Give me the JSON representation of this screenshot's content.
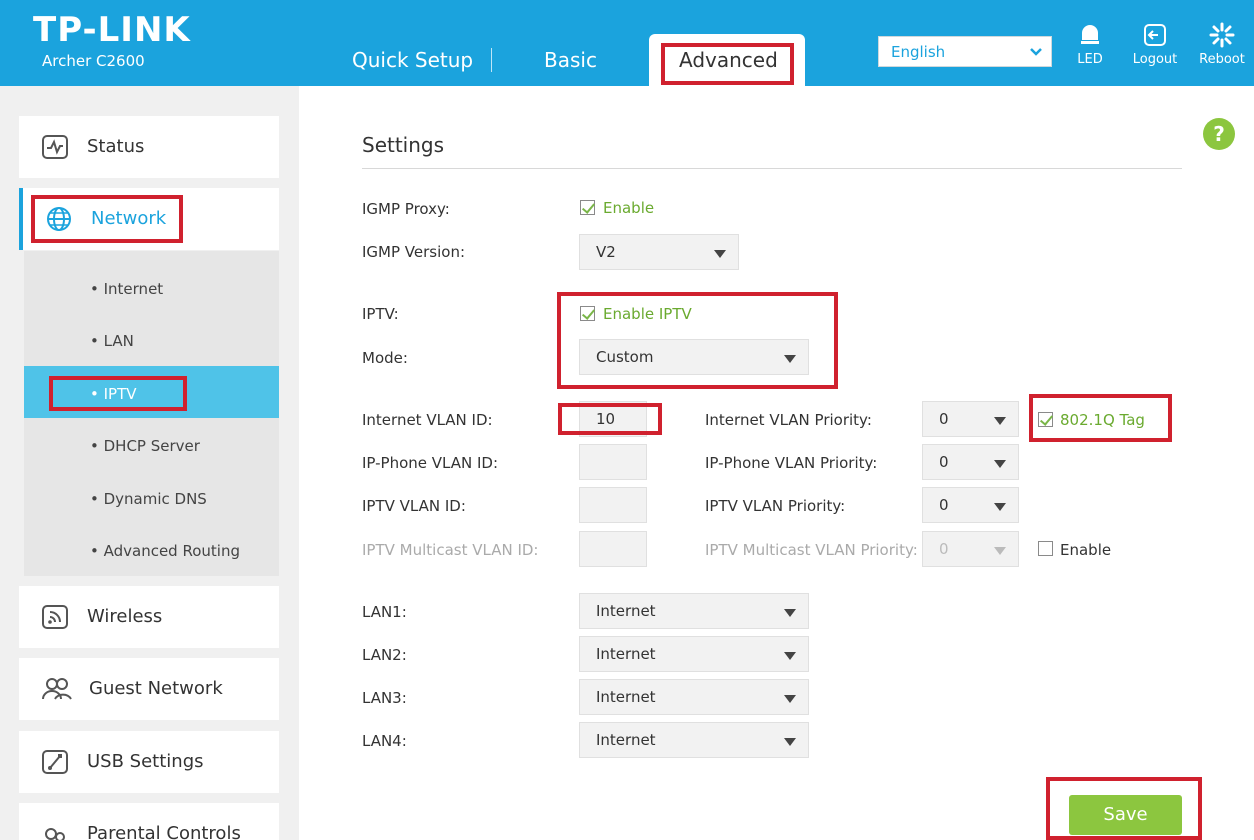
{
  "header": {
    "brand": "TP-LINK",
    "model": "Archer C2600",
    "tabs": {
      "quick_setup": "Quick Setup",
      "basic": "Basic",
      "advanced": "Advanced"
    },
    "language": "English",
    "led_label": "LED",
    "logout_label": "Logout",
    "reboot_label": "Reboot"
  },
  "sidebar": {
    "status": "Status",
    "network": "Network",
    "submenu": [
      "Internet",
      "LAN",
      "IPTV",
      "DHCP Server",
      "Dynamic DNS",
      "Advanced Routing"
    ],
    "wireless": "Wireless",
    "guest_network": "Guest Network",
    "usb_settings": "USB Settings",
    "parental_controls": "Parental Controls"
  },
  "settings": {
    "title": "Settings",
    "igmp_proxy_label": "IGMP Proxy:",
    "igmp_proxy_enable": "Enable",
    "igmp_version_label": "IGMP Version:",
    "igmp_version": "V2",
    "iptv_label": "IPTV:",
    "iptv_enable": "Enable IPTV",
    "mode_label": "Mode:",
    "mode": "Custom",
    "internet_vlan_id_label": "Internet VLAN ID:",
    "internet_vlan_id": "10",
    "internet_vlan_priority_label": "Internet VLAN Priority:",
    "internet_vlan_priority": "0",
    "tag_label": "802.1Q Tag",
    "ipphone_vlan_id_label": "IP-Phone VLAN ID:",
    "ipphone_vlan_id": "",
    "ipphone_vlan_priority_label": "IP-Phone VLAN Priority:",
    "ipphone_vlan_priority": "0",
    "iptv_vlan_id_label": "IPTV VLAN ID:",
    "iptv_vlan_id": "",
    "iptv_vlan_priority_label": "IPTV VLAN Priority:",
    "iptv_vlan_priority": "0",
    "iptv_multicast_vlan_id_label": "IPTV Multicast VLAN ID:",
    "iptv_multicast_vlan_id": "",
    "iptv_multicast_vlan_priority_label": "IPTV Multicast VLAN Priority:",
    "iptv_multicast_vlan_priority": "0",
    "multicast_enable": "Enable",
    "lan1_label": "LAN1:",
    "lan1": "Internet",
    "lan2_label": "LAN2:",
    "lan2": "Internet",
    "lan3_label": "LAN3:",
    "lan3": "Internet",
    "lan4_label": "LAN4:",
    "lan4": "Internet",
    "save": "Save"
  },
  "colors": {
    "header_bg": "#1ba3dd",
    "accent_green": "#8cc63f",
    "selected_sub": "#4fc3e8",
    "annotation_red": "#d0212e"
  }
}
